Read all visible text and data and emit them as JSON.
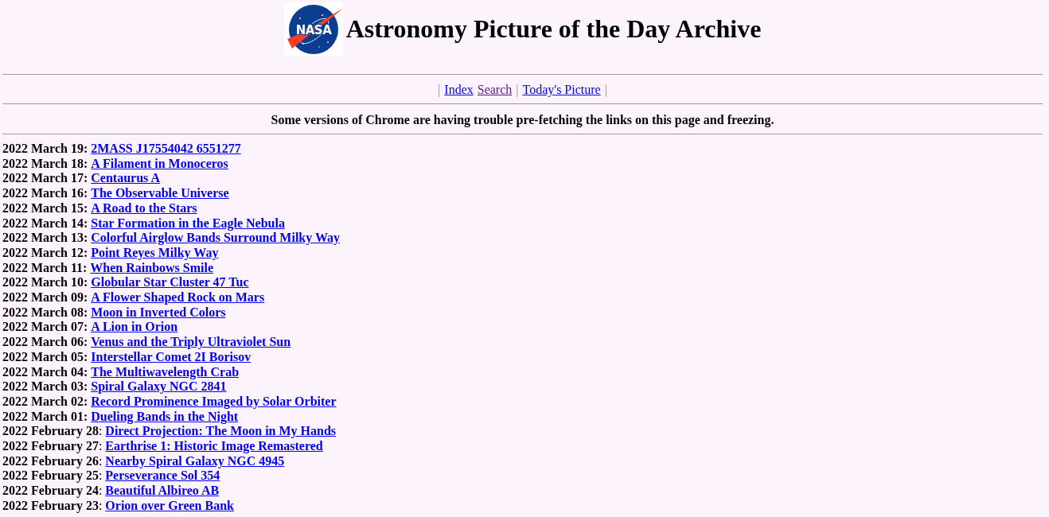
{
  "header": {
    "logo": {
      "text": "NASA"
    },
    "title": "Astronomy Picture of the Day Archive"
  },
  "nav": {
    "items": [
      {
        "kind": "separator",
        "text": "|"
      },
      {
        "kind": "link",
        "text": "Index",
        "visited": false
      },
      {
        "kind": "link",
        "text": "Search",
        "visited": true
      },
      {
        "kind": "separator",
        "text": "|"
      },
      {
        "kind": "link",
        "text": "Today's Picture",
        "visited": false
      },
      {
        "kind": "separator",
        "text": "|"
      }
    ]
  },
  "notice": "Some versions of Chrome are having trouble pre-fetching the links on this page and freezing.",
  "entries": [
    {
      "date": "2022 March 19:",
      "date_bold": true,
      "title": "2MASS J17554042 6551277"
    },
    {
      "date": "2022 March 18:",
      "date_bold": true,
      "title": "A Filament in Monoceros"
    },
    {
      "date": "2022 March 17:",
      "date_bold": true,
      "title": "Centaurus A"
    },
    {
      "date": "2022 March 16:",
      "date_bold": true,
      "title": "The Observable Universe"
    },
    {
      "date": "2022 March 15:",
      "date_bold": true,
      "title": "A Road to the Stars"
    },
    {
      "date": "2022 March 14:",
      "date_bold": true,
      "title": "Star Formation in the Eagle Nebula"
    },
    {
      "date": "2022 March 13:",
      "date_bold": true,
      "title": "Colorful Airglow Bands Surround Milky Way"
    },
    {
      "date": "2022 March 12:",
      "date_bold": true,
      "title": "Point Reyes Milky Way"
    },
    {
      "date": "2022 March 11:",
      "date_bold": true,
      "title": "When Rainbows Smile"
    },
    {
      "date": "2022 March 10:",
      "date_bold": true,
      "title": "Globular Star Cluster 47 Tuc"
    },
    {
      "date": "2022 March 09:",
      "date_bold": true,
      "title": "A Flower Shaped Rock on Mars"
    },
    {
      "date": "2022 March 08:",
      "date_bold": true,
      "title": "Moon in Inverted Colors"
    },
    {
      "date": "2022 March 07:",
      "date_bold": true,
      "title": "A Lion in Orion"
    },
    {
      "date": "2022 March 06:",
      "date_bold": true,
      "title": "Venus and the Triply Ultraviolet Sun"
    },
    {
      "date": "2022 March 05:",
      "date_bold": true,
      "title": "Interstellar Comet 2I Borisov"
    },
    {
      "date": "2022 March 04:",
      "date_bold": true,
      "title": "The Multiwavelength Crab"
    },
    {
      "date": "2022 March 03:",
      "date_bold": true,
      "title": "Spiral Galaxy NGC 2841"
    },
    {
      "date": "2022 March 02:",
      "date_bold": true,
      "title": "Record Prominence Imaged by Solar Orbiter"
    },
    {
      "date": "2022 March 01:",
      "date_bold": true,
      "title": "Dueling Bands in the Night"
    },
    {
      "date": "**2022 February 28**:",
      "date_bold": false,
      "title": "Direct Projection: The Moon in My Hands"
    },
    {
      "date": "**2022 February 27**:",
      "date_bold": false,
      "title": "Earthrise 1: Historic Image Remastered"
    },
    {
      "date": "**2022 February 26**:",
      "date_bold": false,
      "title": "Nearby Spiral Galaxy NGC 4945"
    },
    {
      "date": "**2022 February 25**:",
      "date_bold": false,
      "title": "Perseverance Sol 354"
    },
    {
      "date": "**2022 February 24**:",
      "date_bold": false,
      "title": "Beautiful Albireo AB"
    },
    {
      "date": "**2022 February 23**:",
      "date_bold": false,
      "title": "Orion over Green Bank"
    }
  ]
}
